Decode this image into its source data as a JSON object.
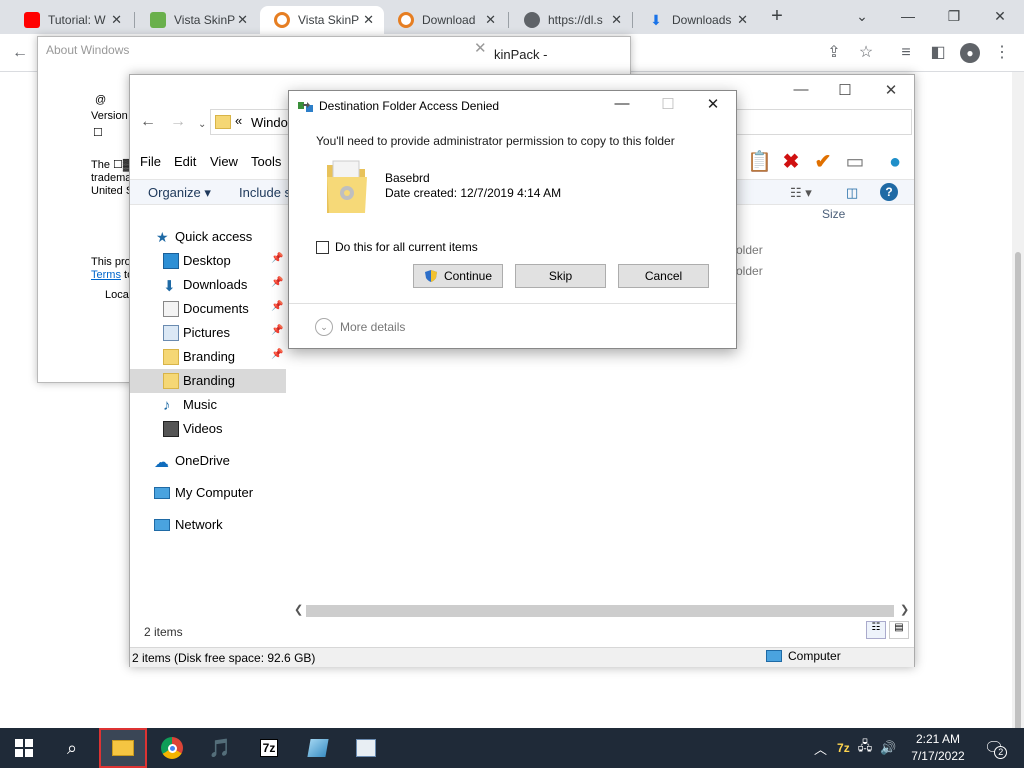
{
  "browser": {
    "tabs": [
      {
        "label": "Tutorial: W",
        "icon": "youtube-icon",
        "color": "#ff0000"
      },
      {
        "label": "Vista SkinP",
        "icon": "site-icon",
        "color": "#6ab04c"
      },
      {
        "label": "Vista SkinP",
        "icon": "site-icon",
        "color": "#e67e22"
      },
      {
        "label": "Download",
        "icon": "site-icon",
        "color": "#e67e22"
      },
      {
        "label": "https://dl.s",
        "icon": "globe-icon",
        "color": "#5f6368"
      },
      {
        "label": "Downloads",
        "icon": "download-icon",
        "color": "#1a73e8"
      }
    ],
    "page_heading_fragment": "kinPack -"
  },
  "about_window": {
    "title": "About Windows",
    "lines": [
      "@",
      "Version",
      "☐",
      "The ☐▓",
      "tradema",
      "United S",
      "This proc",
      "Local"
    ],
    "terms_link": "Terms",
    "terms_suffix": " to"
  },
  "explorer": {
    "address_chevron": "«",
    "address_path": "Window",
    "menu": [
      "File",
      "Edit",
      "View",
      "Tools"
    ],
    "commands": [
      "Organize ▾",
      "Include se"
    ],
    "nav": [
      {
        "label": "Quick access",
        "icon": "star-icon",
        "indent": 0
      },
      {
        "label": "Desktop",
        "icon": "desktop-icon",
        "indent": 1,
        "pinned": true
      },
      {
        "label": "Downloads",
        "icon": "downloads-icon",
        "indent": 1,
        "pinned": true
      },
      {
        "label": "Documents",
        "icon": "documents-icon",
        "indent": 1,
        "pinned": true
      },
      {
        "label": "Pictures",
        "icon": "pictures-icon",
        "indent": 1,
        "pinned": true
      },
      {
        "label": "Branding",
        "icon": "folder-icon",
        "indent": 1,
        "pinned": true
      },
      {
        "label": "Branding",
        "icon": "folder-icon",
        "indent": 1,
        "selected": true
      },
      {
        "label": "Music",
        "icon": "music-icon",
        "indent": 1
      },
      {
        "label": "Videos",
        "icon": "videos-icon",
        "indent": 1
      },
      {
        "label": "OneDrive",
        "icon": "onedrive-icon",
        "indent": 0
      },
      {
        "label": "My Computer",
        "icon": "computer-icon",
        "indent": 0
      },
      {
        "label": "Network",
        "icon": "network-icon",
        "indent": 0
      }
    ],
    "column_header": "Size",
    "rows": [
      "older",
      "older"
    ],
    "item_count": "2 items",
    "status_left": "2 items (Disk free space: 92.6 GB)",
    "status_right": "Computer"
  },
  "dialog": {
    "title": "Destination Folder Access Denied",
    "message": "You'll need to provide administrator permission to copy to this folder",
    "file_name": "Basebrd",
    "file_date": "Date created: 12/7/2019 4:14 AM",
    "checkbox_label": "Do this for all current items",
    "continue_label": "Continue",
    "skip_label": "Skip",
    "cancel_label": "Cancel",
    "more_details": "More details"
  },
  "taskbar": {
    "time": "2:21 AM",
    "date": "7/17/2022",
    "notification_count": "2"
  }
}
